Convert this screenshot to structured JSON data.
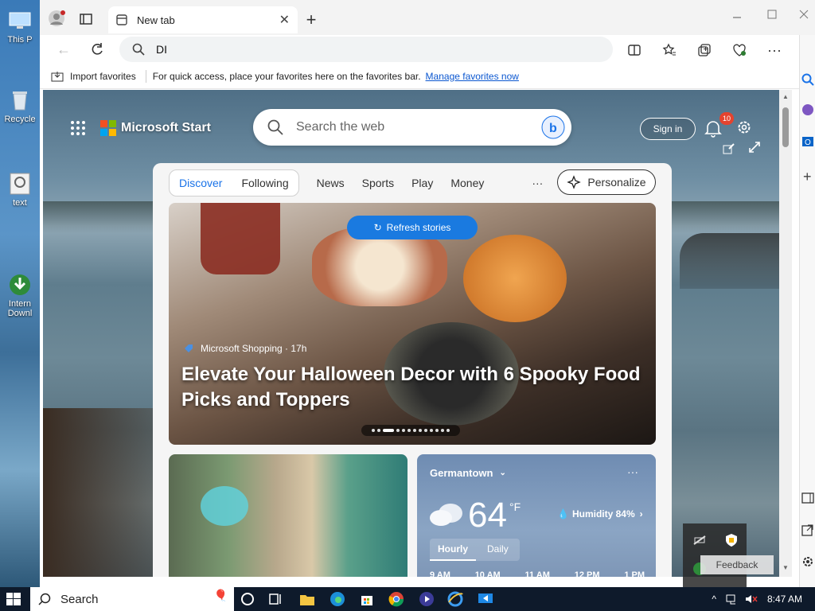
{
  "desktop": {
    "icons": [
      {
        "label": "This P"
      },
      {
        "label": "Recycle"
      },
      {
        "label": "text"
      },
      {
        "label": "Intern\nDownl"
      }
    ]
  },
  "browser": {
    "tab": {
      "title": "New tab"
    },
    "address": {
      "value": "DI"
    },
    "favbar": {
      "import_label": "Import favorites",
      "message": "For quick access, place your favorites here on the favorites bar.",
      "manage_link": "Manage favorites now"
    }
  },
  "start": {
    "brand": "Microsoft Start",
    "search_placeholder": "Search the web",
    "signin_label": "Sign in",
    "notification_count": "10",
    "nav": {
      "discover": "Discover",
      "following": "Following",
      "items": [
        "News",
        "Sports",
        "Play",
        "Money"
      ],
      "more": "···",
      "personalize": "Personalize"
    },
    "hero": {
      "refresh_label": "Refresh stories",
      "source": "Microsoft Shopping · 17h",
      "title": "Elevate Your Halloween Decor with 6 Spooky Food Picks and Toppers",
      "slide_count": 13,
      "active_slide": 3
    },
    "weather": {
      "location": "Germantown",
      "more": "···",
      "temp": "64",
      "unit": "°F",
      "humidity": "Humidity 84%",
      "tabs": [
        "Hourly",
        "Daily"
      ],
      "hours": [
        "9 AM",
        "10 AM",
        "11 AM",
        "12 PM",
        "1 PM"
      ]
    },
    "feedback_label": "Feedback"
  },
  "taskbar": {
    "search_label": "Search",
    "time": "8:47 AM"
  },
  "colors": {
    "accent": "#1a7ae0",
    "link": "#0b57d0",
    "taskbar": "#0e1a2b"
  }
}
